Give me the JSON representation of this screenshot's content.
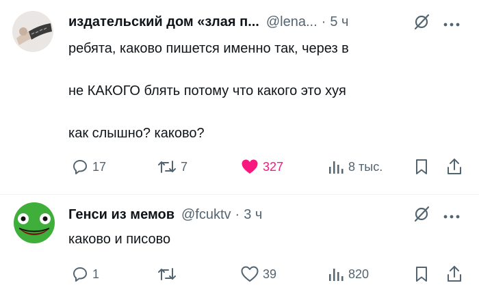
{
  "post1": {
    "author_name": "издательский дом «злая п...",
    "handle": "@lena...",
    "separator": "·",
    "time": "5 ч",
    "lines": [
      "ребята, каково пишется именно так, через в",
      "не КАКОГО блять потому что какого это хуя",
      "как слышно? каково?"
    ],
    "actions": {
      "replies": "17",
      "reposts": "7",
      "likes": "327",
      "views": "8 тыс."
    },
    "like_color": "#f91880"
  },
  "post2": {
    "author_name": "Генси из мемов",
    "handle": "@fcuktv",
    "separator": "·",
    "time": "3 ч",
    "lines": [
      "каково и писово"
    ],
    "actions": {
      "replies": "1",
      "reposts": "",
      "likes": "39",
      "views": "820"
    }
  },
  "icons": [
    "grok-icon",
    "more-icon",
    "reply-icon",
    "repost-icon",
    "like-icon",
    "views-icon",
    "bookmark-icon",
    "share-icon"
  ],
  "colors": {
    "text": "#0f1419",
    "secondary": "#536471",
    "like": "#f91880",
    "divider": "#eff3f4"
  }
}
